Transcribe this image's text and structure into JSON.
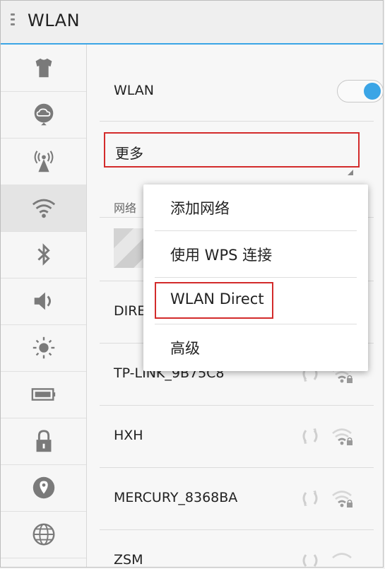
{
  "header": {
    "title": "WLAN"
  },
  "main": {
    "wlan_label": "WLAN",
    "wlan_toggle_on": true,
    "more_label": "更多",
    "section_label": "网络",
    "networks": [
      {
        "ssid": ""
      },
      {
        "ssid": "DIRECT-"
      },
      {
        "ssid": "TP-LINK_9B75C8"
      },
      {
        "ssid": "HXH"
      },
      {
        "ssid": "MERCURY_8368BA"
      },
      {
        "ssid": "ZSM"
      }
    ]
  },
  "popup": {
    "items": [
      {
        "label": "添加网络"
      },
      {
        "label": "使用 WPS 连接"
      },
      {
        "label": "WLAN Direct"
      },
      {
        "label": "高级"
      }
    ]
  },
  "colors": {
    "accent": "#3ba5e6",
    "highlight": "#d32b2b",
    "icon": "#7a7a7a"
  },
  "sidebar": {
    "icons": [
      "theme-icon",
      "cloud-icon",
      "hotspot-icon",
      "wifi-icon",
      "bluetooth-icon",
      "sound-icon",
      "brightness-icon",
      "battery-icon",
      "lock-icon",
      "location-icon",
      "globe-icon"
    ]
  }
}
